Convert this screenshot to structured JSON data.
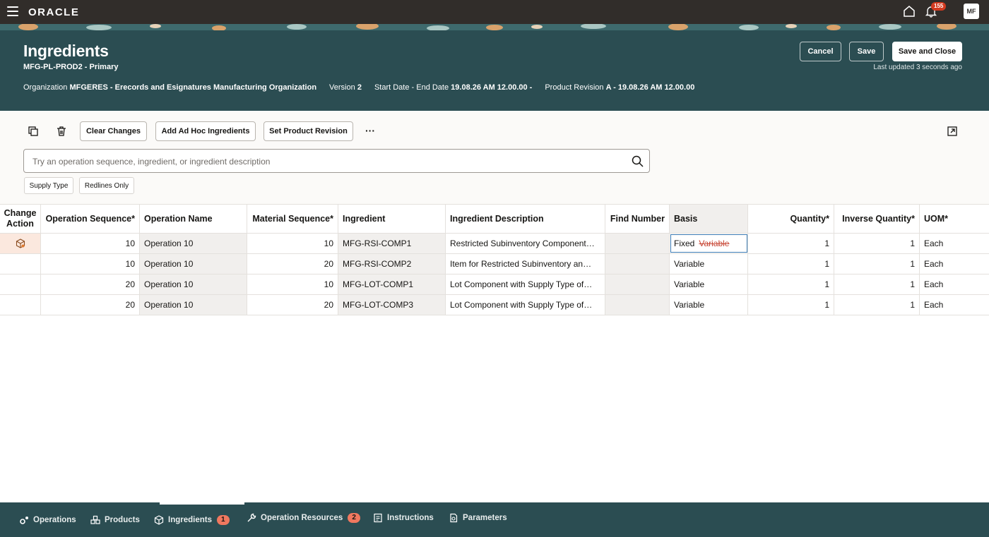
{
  "app": {
    "logo": "ORACLE",
    "notifications": "155",
    "avatar": "MF"
  },
  "header": {
    "title": "Ingredients",
    "subtitle": "MFG-PL-PROD2 - Primary",
    "organization_label": "Organization",
    "organization_value": "MFGERES - Erecords and Esignatures Manufacturing Organization",
    "version_label": "Version",
    "version_value": "2",
    "dates_label": "Start Date - End Date",
    "dates_value": "19.08.26 AM 12.00.00 -",
    "revision_label": "Product Revision",
    "revision_value": "A - 19.08.26 AM 12.00.00",
    "cancel": "Cancel",
    "save": "Save",
    "save_close": "Save and Close",
    "last_updated": "Last updated 3 seconds ago"
  },
  "toolbar": {
    "clear_changes": "Clear Changes",
    "add_adhoc": "Add Ad Hoc Ingredients",
    "set_revision": "Set Product Revision",
    "more": "···"
  },
  "search": {
    "placeholder": "Try an operation sequence, ingredient, or ingredient description"
  },
  "filters": [
    "Supply Type",
    "Redlines Only"
  ],
  "grid": {
    "columns": [
      "Change Action",
      "Operation Sequence*",
      "Operation Name",
      "Material Sequence*",
      "Ingredient",
      "Ingredient Description",
      "Find Number",
      "Basis",
      "Quantity*",
      "Inverse Quantity*",
      "UOM*"
    ],
    "rows": [
      {
        "op_seq": "10",
        "op_name": "Operation 10",
        "mat_seq": "10",
        "ingredient": "MFG-RSI-COMP1",
        "desc": "Restricted Subinventory Component…",
        "find": "",
        "basis": "Fixed",
        "basis_old": "Variable",
        "qty": "1",
        "inv_qty": "1",
        "uom": "Each"
      },
      {
        "op_seq": "10",
        "op_name": "Operation 10",
        "mat_seq": "20",
        "ingredient": "MFG-RSI-COMP2",
        "desc": "Item for Restricted Subinventory an…",
        "find": "",
        "basis": "Variable",
        "basis_old": "",
        "qty": "1",
        "inv_qty": "1",
        "uom": "Each"
      },
      {
        "op_seq": "20",
        "op_name": "Operation 10",
        "mat_seq": "10",
        "ingredient": "MFG-LOT-COMP1",
        "desc": "Lot Component with Supply Type of…",
        "find": "",
        "basis": "Variable",
        "basis_old": "",
        "qty": "1",
        "inv_qty": "1",
        "uom": "Each"
      },
      {
        "op_seq": "20",
        "op_name": "Operation 10",
        "mat_seq": "20",
        "ingredient": "MFG-LOT-COMP3",
        "desc": "Lot Component with Supply Type of…",
        "find": "",
        "basis": "Variable",
        "basis_old": "",
        "qty": "1",
        "inv_qty": "1",
        "uom": "Each"
      }
    ]
  },
  "bottom_nav": {
    "operations": "Operations",
    "products": "Products",
    "ingredients": "Ingredients",
    "ingredients_badge": "1",
    "resources": "Operation Resources",
    "resources_badge": "2",
    "instructions": "Instructions",
    "parameters": "Parameters"
  }
}
